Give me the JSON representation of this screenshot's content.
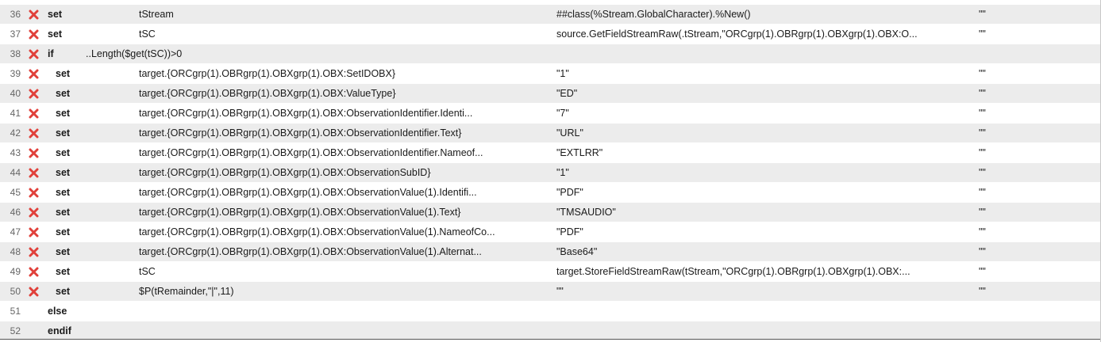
{
  "rows": [
    {
      "num": "36",
      "has_delete": true,
      "keyword": "set",
      "indent": 0,
      "property": "tStream",
      "value": "##class(%Stream.GlobalCharacter).%New()",
      "action": "\"\""
    },
    {
      "num": "37",
      "has_delete": true,
      "keyword": "set",
      "indent": 0,
      "property": "tSC",
      "value": "source.GetFieldStreamRaw(.tStream,\"ORCgrp(1).OBRgrp(1).OBXgrp(1).OBX:O...",
      "action": "\"\""
    },
    {
      "num": "38",
      "has_delete": true,
      "keyword": "if",
      "indent": 0,
      "condition": "..Length($get(tSC))>0",
      "property": "",
      "value": "",
      "action": ""
    },
    {
      "num": "39",
      "has_delete": true,
      "keyword": "set",
      "indent": 1,
      "property": "target.{ORCgrp(1).OBRgrp(1).OBXgrp(1).OBX:SetIDOBX}",
      "value": "\"1\"",
      "action": "\"\""
    },
    {
      "num": "40",
      "has_delete": true,
      "keyword": "set",
      "indent": 1,
      "property": "target.{ORCgrp(1).OBRgrp(1).OBXgrp(1).OBX:ValueType}",
      "value": "\"ED\"",
      "action": "\"\""
    },
    {
      "num": "41",
      "has_delete": true,
      "keyword": "set",
      "indent": 1,
      "property": "target.{ORCgrp(1).OBRgrp(1).OBXgrp(1).OBX:ObservationIdentifier.Identi...",
      "value": "\"7\"",
      "action": "\"\""
    },
    {
      "num": "42",
      "has_delete": true,
      "keyword": "set",
      "indent": 1,
      "property": "target.{ORCgrp(1).OBRgrp(1).OBXgrp(1).OBX:ObservationIdentifier.Text}",
      "value": "\"URL\"",
      "action": "\"\""
    },
    {
      "num": "43",
      "has_delete": true,
      "keyword": "set",
      "indent": 1,
      "property": "target.{ORCgrp(1).OBRgrp(1).OBXgrp(1).OBX:ObservationIdentifier.Nameof...",
      "value": "\"EXTLRR\"",
      "action": "\"\""
    },
    {
      "num": "44",
      "has_delete": true,
      "keyword": "set",
      "indent": 1,
      "property": "target.{ORCgrp(1).OBRgrp(1).OBXgrp(1).OBX:ObservationSubID}",
      "value": "\"1\"",
      "action": "\"\""
    },
    {
      "num": "45",
      "has_delete": true,
      "keyword": "set",
      "indent": 1,
      "property": "target.{ORCgrp(1).OBRgrp(1).OBXgrp(1).OBX:ObservationValue(1).Identifi...",
      "value": "\"PDF\"",
      "action": "\"\""
    },
    {
      "num": "46",
      "has_delete": true,
      "keyword": "set",
      "indent": 1,
      "property": "target.{ORCgrp(1).OBRgrp(1).OBXgrp(1).OBX:ObservationValue(1).Text}",
      "value": "\"TMSAUDIO\"",
      "action": "\"\""
    },
    {
      "num": "47",
      "has_delete": true,
      "keyword": "set",
      "indent": 1,
      "property": "target.{ORCgrp(1).OBRgrp(1).OBXgrp(1).OBX:ObservationValue(1).NameofCo...",
      "value": "\"PDF\"",
      "action": "\"\""
    },
    {
      "num": "48",
      "has_delete": true,
      "keyword": "set",
      "indent": 1,
      "property": "target.{ORCgrp(1).OBRgrp(1).OBXgrp(1).OBX:ObservationValue(1).Alternat...",
      "value": "\"Base64\"",
      "action": "\"\""
    },
    {
      "num": "49",
      "has_delete": true,
      "keyword": "set",
      "indent": 1,
      "property": "tSC",
      "value": "target.StoreFieldStreamRaw(tStream,\"ORCgrp(1).OBRgrp(1).OBXgrp(1).OBX:...",
      "action": "\"\""
    },
    {
      "num": "50",
      "has_delete": true,
      "keyword": "set",
      "indent": 1,
      "property": "$P(tRemainder,\"|\",11)",
      "value": "\"\"",
      "action": "\"\""
    },
    {
      "num": "51",
      "has_delete": false,
      "keyword": "else",
      "indent": 0,
      "property": "",
      "value": "",
      "action": ""
    },
    {
      "num": "52",
      "has_delete": false,
      "keyword": "endif",
      "indent": 0,
      "property": "",
      "value": "",
      "action": ""
    }
  ],
  "icons": {
    "delete": "delete-x-icon"
  },
  "colors": {
    "delete_red": "#e0403a",
    "row_shade": "#ececec",
    "row_plain": "#ffffff"
  }
}
